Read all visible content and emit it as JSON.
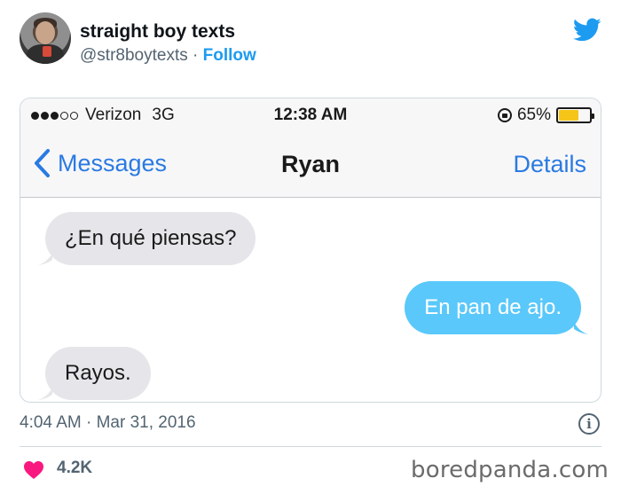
{
  "tweet": {
    "display_name": "straight boy texts",
    "handle": "@str8boytexts",
    "separator": "·",
    "follow_label": "Follow",
    "timestamp": "4:04 AM · Mar 31, 2016",
    "likes": "4.2K"
  },
  "phone": {
    "carrier": "Verizon",
    "network": "3G",
    "time": "12:38 AM",
    "battery_percent": "65%",
    "battery_level": 0.65,
    "back_label": "Messages",
    "contact": "Ryan",
    "details_label": "Details"
  },
  "messages": [
    {
      "side": "received",
      "text": "¿En qué piensas?"
    },
    {
      "side": "sent",
      "text": "En pan de ajo."
    },
    {
      "side": "received",
      "text": "Rayos."
    }
  ],
  "watermark": "boredpanda.com",
  "colors": {
    "twitter_blue": "#1d9bf0",
    "ios_blue": "#2a7ae2",
    "sent_bubble": "#5ac8fa",
    "received_bubble": "#e6e6ea",
    "like_red": "#f91880",
    "battery_yellow": "#f5c518"
  },
  "icons": [
    "twitter-bird-icon",
    "signal-dots-icon",
    "rotation-lock-icon",
    "battery-icon",
    "chevron-left-icon",
    "info-icon",
    "heart-icon"
  ]
}
